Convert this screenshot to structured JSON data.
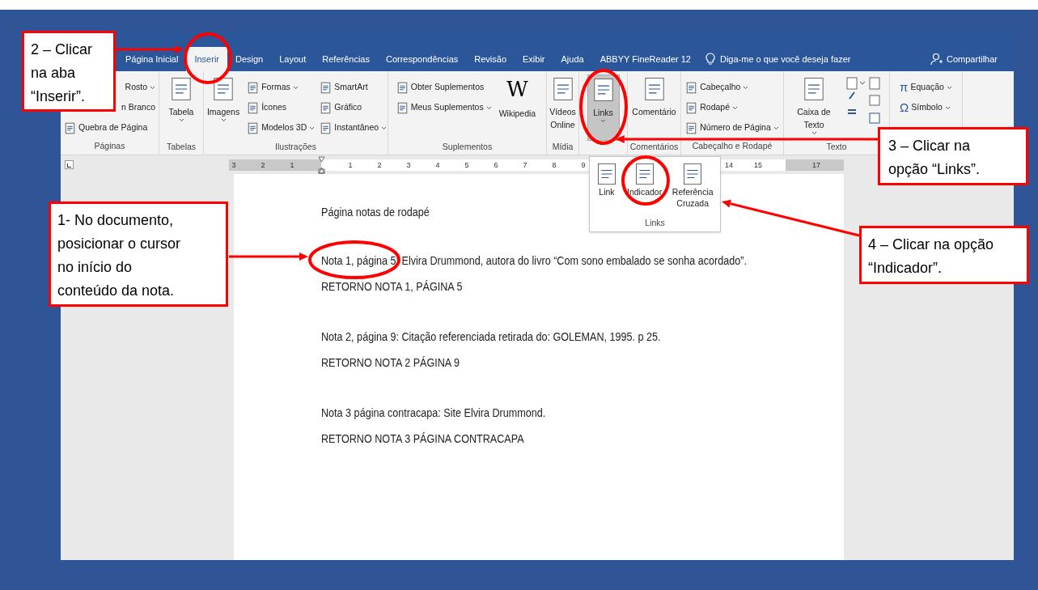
{
  "tabs": [
    {
      "label": "Página Inicial",
      "selected": false
    },
    {
      "label": "Inserir",
      "selected": true
    },
    {
      "label": "Design",
      "selected": false
    },
    {
      "label": "Layout",
      "selected": false
    },
    {
      "label": "Referências",
      "selected": false
    },
    {
      "label": "Correspondências",
      "selected": false
    },
    {
      "label": "Revisão",
      "selected": false
    },
    {
      "label": "Exibir",
      "selected": false
    },
    {
      "label": "Ajuda",
      "selected": false
    },
    {
      "label": "ABBYY FineReader 12",
      "selected": false
    }
  ],
  "tell_me": "Diga-me o que você deseja fazer",
  "share": "Compartilhar",
  "ribbon": {
    "groups": [
      {
        "label": "Páginas",
        "columns": [
          {
            "kind": "stack",
            "items": [
              {
                "label": "Rosto",
                "dropdown": true,
                "icon": false
              },
              {
                "label": "n Branco",
                "dropdown": false,
                "icon": false
              },
              {
                "label": "Quebra de Página",
                "dropdown": false,
                "icon": true
              }
            ]
          }
        ]
      },
      {
        "label": "Tabelas",
        "columns": [
          {
            "kind": "large",
            "label": "Tabela",
            "dropdown": true,
            "pressed": false
          }
        ]
      },
      {
        "label": "Ilustrações",
        "columns": [
          {
            "kind": "large",
            "label": "Imagens",
            "dropdown": true,
            "pressed": false
          },
          {
            "kind": "stack",
            "items": [
              {
                "label": "Formas",
                "dropdown": true,
                "icon": true
              },
              {
                "label": "Ícones",
                "dropdown": false,
                "icon": true
              },
              {
                "label": "Modelos 3D",
                "dropdown": true,
                "icon": true
              }
            ]
          },
          {
            "kind": "stack",
            "items": [
              {
                "label": "SmartArt",
                "dropdown": false,
                "icon": true
              },
              {
                "label": "Gráfico",
                "dropdown": false,
                "icon": true
              },
              {
                "label": "Instantâneo",
                "dropdown": true,
                "icon": true
              }
            ]
          }
        ]
      },
      {
        "label": "Suplementos",
        "columns": [
          {
            "kind": "stack",
            "items": [
              {
                "label": "Obter Suplementos",
                "dropdown": false,
                "icon": true
              },
              {
                "label": "Meus Suplementos",
                "dropdown": true,
                "icon": true
              }
            ]
          },
          {
            "kind": "large",
            "label": "Wikipedia",
            "glyph": "W",
            "dropdown": false,
            "pressed": false
          }
        ]
      },
      {
        "label": "Mídia",
        "columns": [
          {
            "kind": "large",
            "label": "Vídeos Online",
            "dropdown": false,
            "pressed": false
          }
        ]
      },
      {
        "columns": [
          {
            "kind": "large",
            "label": "Links",
            "dropdown": true,
            "pressed": true
          }
        ]
      },
      {
        "label": "Comentários",
        "columns": [
          {
            "kind": "large",
            "label": "Comentário",
            "dropdown": false,
            "pressed": false
          }
        ]
      },
      {
        "label": "Cabeçalho e Rodapé",
        "columns": [
          {
            "kind": "stack",
            "items": [
              {
                "label": "Cabeçalho",
                "dropdown": true,
                "icon": true
              },
              {
                "label": "Rodapé",
                "dropdown": true,
                "icon": true
              },
              {
                "label": "Número de Página",
                "dropdown": true,
                "icon": true
              }
            ]
          }
        ]
      },
      {
        "label": "Texto",
        "columns": [
          {
            "kind": "large",
            "label": "Caixa de Texto",
            "dropdown": true,
            "pressed": false
          },
          {
            "kind": "tools"
          }
        ]
      },
      {
        "columns": [
          {
            "kind": "stack",
            "items": [
              {
                "label": "Equação",
                "glyph": "π",
                "dropdown": true,
                "icon": true
              },
              {
                "label": "Símbolo",
                "glyph": "Ω",
                "dropdown": true,
                "icon": true
              }
            ]
          }
        ]
      }
    ]
  },
  "ruler": {
    "marks": [
      "3",
      "2",
      "1",
      "1",
      "2",
      "3",
      "4",
      "5",
      "6",
      "7",
      "8",
      "9",
      "14",
      "15",
      "17"
    ]
  },
  "links_menu": {
    "items": [
      "Link",
      "Indicador",
      "Referência Cruzada"
    ],
    "label": "Links"
  },
  "document": {
    "paragraphs": [
      "Página notas de rodapé",
      "Nota 1, página 5: Elvira Drummond, autora do livro “Com sono embalado se sonha acordado”.",
      "RETORNO NOTA 1, PÁGINA 5",
      "Nota 2, página 9: Citação referenciada retirada do: GOLEMAN, 1995. p 25.",
      "RETORNO NOTA 2 PÁGINA 9",
      "Nota 3 página contracapa: Site Elvira Drummond.",
      "RETORNO NOTA 3 PÁGINA CONTRACAPA"
    ]
  },
  "callouts": [
    "2 – Clicar na aba “Inserir”.",
    "3 – Clicar na opção “Links”.",
    "1- No documento, posicionar o cursor no início do conteúdo da nota.",
    "4 – Clicar na opção “Indicador”."
  ]
}
